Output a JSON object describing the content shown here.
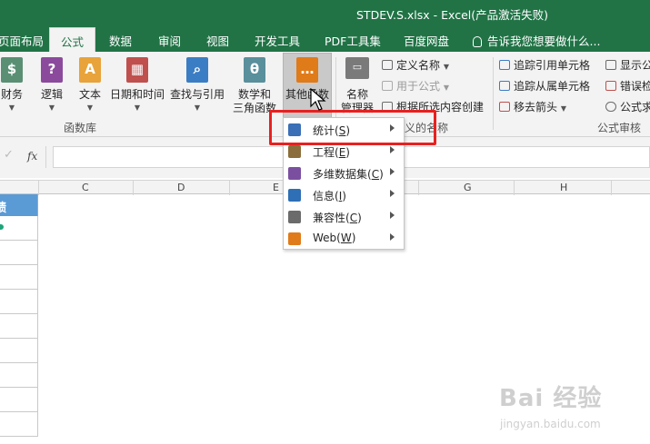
{
  "window": {
    "title": "STDEV.S.xlsx - Excel(产品激活失败)"
  },
  "tabs": [
    {
      "label": "页面布局"
    },
    {
      "label": "公式"
    },
    {
      "label": "数据"
    },
    {
      "label": "审阅"
    },
    {
      "label": "视图"
    },
    {
      "label": "开发工具"
    },
    {
      "label": "PDF工具集"
    },
    {
      "label": "百度网盘"
    }
  ],
  "tell_me": "告诉我您想要做什么...",
  "ribbon": {
    "function_library": {
      "buttons": [
        {
          "label": "财务",
          "icon": "finance-icon"
        },
        {
          "label": "逻辑",
          "icon": "logic-icon"
        },
        {
          "label": "文本",
          "icon": "text-icon"
        },
        {
          "label": "日期和时间",
          "icon": "calendar-icon"
        },
        {
          "label": "查找与引用",
          "icon": "lookup-icon"
        },
        {
          "label": "数学和",
          "label2": "三角函数",
          "icon": "theta-icon"
        },
        {
          "label": "其他函数",
          "icon": "more-functions-icon"
        }
      ],
      "group_label": "函数库"
    },
    "defined_names": {
      "manager_label": "名称",
      "manager_label2": "管理器",
      "define_name": "定义名称",
      "use_in_formula": "用于公式",
      "create_from_selection": "根据所选内容创建",
      "group_label": "义的名称"
    },
    "formula_auditing": {
      "trace_precedents": "追踪引用单元格",
      "trace_dependents": "追踪从属单元格",
      "remove_arrows": "移去箭头",
      "show_formulas": "显示公",
      "error_checking": "错误检",
      "evaluate_formula": "公式求",
      "group_label": "公式审核"
    }
  },
  "formula_bar": {
    "fx_label": "fx",
    "value": ""
  },
  "columns": [
    "C",
    "D",
    "E",
    "G",
    "H"
  ],
  "sheet": {
    "visible_header": "绩"
  },
  "menu": {
    "items": [
      {
        "label": "统计",
        "key": "S",
        "icon": "statistics-icon",
        "color": "#3b6fb6"
      },
      {
        "label": "工程",
        "key": "E",
        "icon": "engineering-icon",
        "color": "#8a6d3b"
      },
      {
        "label": "多维数据集",
        "key": "C",
        "icon": "cube-icon",
        "color": "#7b4fa0"
      },
      {
        "label": "信息",
        "key": "I",
        "icon": "info-icon",
        "color": "#2e6fb5"
      },
      {
        "label": "兼容性",
        "key": "C",
        "icon": "compatibility-icon",
        "color": "#6b6b6b"
      },
      {
        "label": "Web",
        "key": "W",
        "icon": "web-icon",
        "color": "#e07b1a"
      }
    ]
  },
  "watermark": {
    "text": "Bai 经验",
    "sub": "jingyan.baidu.com"
  },
  "colors": {
    "excel_green": "#217346",
    "highlight_red": "#e8201f",
    "header_blue": "#5b9bd5"
  }
}
